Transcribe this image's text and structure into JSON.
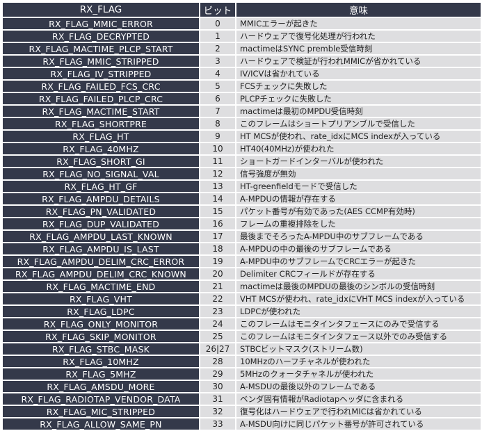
{
  "headers": [
    "RX_FLAG",
    "ビット",
    "意味"
  ],
  "rows": [
    {
      "flag": "RX_FLAG_MMIC_ERROR",
      "bit": "0",
      "desc": "MMICエラーが起きた"
    },
    {
      "flag": "RX_FLAG_DECRYPTED",
      "bit": "1",
      "desc": "ハードウェアで復号化処理が行われた"
    },
    {
      "flag": "RX_FLAG_MACTIME_PLCP_START",
      "bit": "2",
      "desc": "mactimeはSYNC premble受信時刻"
    },
    {
      "flag": "RX_FLAG_MMIC_STRIPPED",
      "bit": "3",
      "desc": "ハードウェアで検証が行われMMICが省かれている"
    },
    {
      "flag": "RX_FLAG_IV_STRIPPED",
      "bit": "4",
      "desc": "IV/ICVは省かれている"
    },
    {
      "flag": "RX_FLAG_FAILED_FCS_CRC",
      "bit": "5",
      "desc": "FCSチェックに失敗した"
    },
    {
      "flag": "RX_FLAG_FAILED_PLCP_CRC",
      "bit": "6",
      "desc": "PLCPチェックに失敗した"
    },
    {
      "flag": "RX_FLAG_MACTIME_START",
      "bit": "7",
      "desc": "mactimeは最初のMPDU受信時刻"
    },
    {
      "flag": "RX_FLAG_SHORTPRE",
      "bit": "8",
      "desc": "このフレームはショートプリアンブルで受信した"
    },
    {
      "flag": "RX_FLAG_HT",
      "bit": "9",
      "desc": "HT MCSが使われ、rate_idxにMCS indexが入っている"
    },
    {
      "flag": "RX_FLAG_40MHZ",
      "bit": "10",
      "desc": "HT40(40MHz)が使われた"
    },
    {
      "flag": "RX_FLAG_SHORT_GI",
      "bit": "11",
      "desc": "ショートガードインターバルが使われた"
    },
    {
      "flag": "RX_FLAG_NO_SIGNAL_VAL",
      "bit": "12",
      "desc": "信号強度が無効"
    },
    {
      "flag": "RX_FLAG_HT_GF",
      "bit": "13",
      "desc": "HT-greenfieldモードで受信した"
    },
    {
      "flag": "RX_FLAG_AMPDU_DETAILS",
      "bit": "14",
      "desc": "A-MPDUの情報が存在する"
    },
    {
      "flag": "RX_FLAG_PN_VALIDATED",
      "bit": "15",
      "desc": "パケット番号が有効であった(AES CCMP有効時)"
    },
    {
      "flag": "RX_FLAG_DUP_VALIDATED",
      "bit": "16",
      "desc": "フレームの重複排除をした"
    },
    {
      "flag": "RX_FLAG_AMPDU_LAST_KNOWN",
      "bit": "17",
      "desc": "最後までそろったA-MPDU中のサブフレームである"
    },
    {
      "flag": "RX_FLAG_AMPDU_IS_LAST",
      "bit": "18",
      "desc": "A-MPDUの中の最後のサブフレームである"
    },
    {
      "flag": "RX_FLAG_AMPDU_DELIM_CRC_ERROR",
      "bit": "19",
      "desc": "A-MPDU中のサブフレームでCRCエラーが起きた"
    },
    {
      "flag": "RX_FLAG_AMPDU_DELIM_CRC_KNOWN",
      "bit": "20",
      "desc": "Delimiter CRCフィールドが存在する"
    },
    {
      "flag": "RX_FLAG_MACTIME_END",
      "bit": "21",
      "desc": "mactimeは最後のMPDUの最後のシンボルの受信時刻"
    },
    {
      "flag": "RX_FLAG_VHT",
      "bit": "22",
      "desc": "VHT MCSが使われ、rate_idxにVHT MCS indexが入っている"
    },
    {
      "flag": "RX_FLAG_LDPC",
      "bit": "23",
      "desc": "LDPCが使われた"
    },
    {
      "flag": "RX_FLAG_ONLY_MONITOR",
      "bit": "24",
      "desc": "このフレームはモニタインタフェースにのみで受信する"
    },
    {
      "flag": "RX_FLAG_SKIP_MONITOR",
      "bit": "25",
      "desc": "このフレームはモニタインタフェース以外でのみ受信する"
    },
    {
      "flag": "RX_FLAG_STBC_MASK",
      "bit": "26|27",
      "desc": "STBCビットマスク(ストリーム数)"
    },
    {
      "flag": "RX_FLAG_10MHZ",
      "bit": "28",
      "desc": "10MHzのハーフチャネルが使われた"
    },
    {
      "flag": "RX_FLAG_5MHZ",
      "bit": "29",
      "desc": "5MHzのクォータチャネルが使われた"
    },
    {
      "flag": "RX_FLAG_AMSDU_MORE",
      "bit": "30",
      "desc": "A-MSDUの最後以外のフレームである"
    },
    {
      "flag": "RX_FLAG_RADIOTAP_VENDOR_DATA",
      "bit": "31",
      "desc": "ベンダ固有情報がRadiotapヘッダに含まれる"
    },
    {
      "flag": "RX_FLAG_MIC_STRIPPED",
      "bit": "32",
      "desc": "復号化はハードウェアで行われMICは省かれている"
    },
    {
      "flag": "RX_FLAG_ALLOW_SAME_PN",
      "bit": "33",
      "desc": "A-MSDU向けに同じパケット番号が許可されている"
    }
  ]
}
